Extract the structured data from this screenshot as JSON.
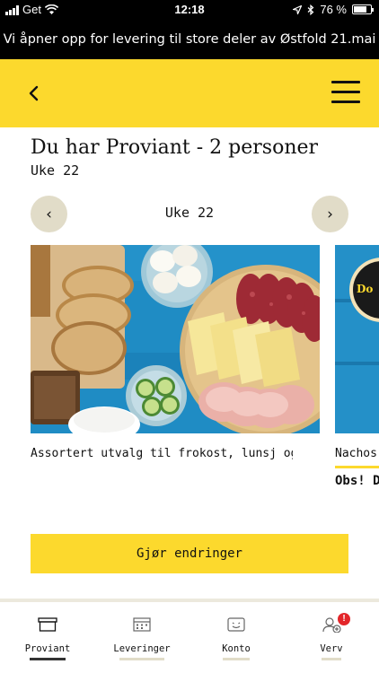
{
  "status_bar": {
    "carrier": "Get",
    "time": "12:18",
    "battery": "76 %",
    "battery_level": 0.76
  },
  "banner": {
    "text": "Vi åpner opp for levering til store deler av Østfold 21.mai"
  },
  "header": {
    "back_icon": "chevron-left-icon",
    "menu_icon": "hamburger-menu-icon",
    "brand_color": "#fcd92d"
  },
  "page": {
    "title": "Du har Proviant - 2 personer",
    "subtitle": "Uke 22"
  },
  "week_selector": {
    "label": "Uke 22",
    "prev": "‹",
    "next": "›"
  },
  "cards": [
    {
      "caption": "Assortert utvalg til frokost, lunsj og kvelds"
    },
    {
      "caption": "Nachos",
      "extra": "Obs! D",
      "badge_text": "Do"
    }
  ],
  "actions": {
    "primary": "Gjør endringer"
  },
  "tabs": [
    {
      "label": "Proviant",
      "icon": "box-icon",
      "active": true
    },
    {
      "label": "Leveringer",
      "icon": "calendar-icon",
      "active": false
    },
    {
      "label": "Konto",
      "icon": "account-icon",
      "active": false
    },
    {
      "label": "Verv",
      "icon": "add-person-icon",
      "active": false,
      "badge": "!"
    }
  ]
}
